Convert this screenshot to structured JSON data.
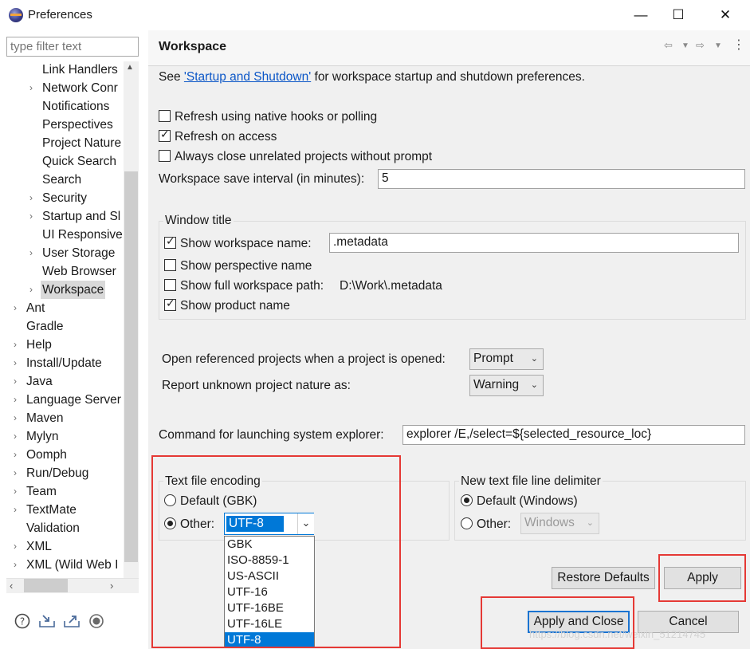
{
  "window": {
    "title": "Preferences",
    "minimize": "—",
    "maximize": "☐",
    "close": "✕"
  },
  "sidebar": {
    "filter_placeholder": "type filter text",
    "items": [
      {
        "label": "Link Handlers",
        "twisty": ""
      },
      {
        "label": "Network Conr",
        "twisty": "›"
      },
      {
        "label": "Notifications",
        "twisty": ""
      },
      {
        "label": "Perspectives",
        "twisty": ""
      },
      {
        "label": "Project Nature",
        "twisty": ""
      },
      {
        "label": "Quick Search",
        "twisty": ""
      },
      {
        "label": "Search",
        "twisty": ""
      },
      {
        "label": "Security",
        "twisty": "›"
      },
      {
        "label": "Startup and Sl",
        "twisty": "›"
      },
      {
        "label": "UI Responsive",
        "twisty": ""
      },
      {
        "label": "User Storage",
        "twisty": "›"
      },
      {
        "label": "Web Browser",
        "twisty": ""
      },
      {
        "label": "Workspace",
        "twisty": "›"
      },
      {
        "label": "Ant",
        "twisty": "›"
      },
      {
        "label": "Gradle",
        "twisty": ""
      },
      {
        "label": "Help",
        "twisty": "›"
      },
      {
        "label": "Install/Update",
        "twisty": "›"
      },
      {
        "label": "Java",
        "twisty": "›"
      },
      {
        "label": "Language Server",
        "twisty": "›"
      },
      {
        "label": "Maven",
        "twisty": "›"
      },
      {
        "label": "Mylyn",
        "twisty": "›"
      },
      {
        "label": "Oomph",
        "twisty": "›"
      },
      {
        "label": "Run/Debug",
        "twisty": "›"
      },
      {
        "label": "Team",
        "twisty": "›"
      },
      {
        "label": "TextMate",
        "twisty": "›"
      },
      {
        "label": "Validation",
        "twisty": ""
      },
      {
        "label": "XML",
        "twisty": "›"
      },
      {
        "label": "XML (Wild Web I",
        "twisty": "›"
      }
    ],
    "bottom_icons": [
      "help-icon",
      "import-icon",
      "export-icon",
      "record-icon"
    ]
  },
  "page": {
    "title": "Workspace",
    "see_prefix": "See ",
    "see_link": "'Startup and Shutdown'",
    "see_suffix": " for workspace startup and shutdown preferences.",
    "refresh_native": "Refresh using native hooks or polling",
    "refresh_access": "Refresh on access",
    "always_close": "Always close unrelated projects without prompt",
    "save_interval_label": "Workspace save interval (in minutes):",
    "save_interval_value": "5",
    "window_title_group": "Window title",
    "show_ws_name": "Show workspace name:",
    "ws_name_value": ".metadata",
    "show_perspective": "Show perspective name",
    "show_full_path": "Show full workspace path:",
    "full_path_value": "D:\\Work\\.metadata",
    "show_product": "Show product name",
    "open_ref_label": "Open referenced projects when a project is opened:",
    "open_ref_value": "Prompt",
    "report_nature_label": "Report unknown project nature as:",
    "report_nature_value": "Warning",
    "command_label": "Command for launching system explorer:",
    "command_value": "explorer /E,/select=${selected_resource_loc}",
    "encoding_group": "Text file encoding",
    "encoding_default": "Default (GBK)",
    "encoding_other": "Other:",
    "encoding_value": "UTF-8",
    "encoding_options": [
      "GBK",
      "ISO-8859-1",
      "US-ASCII",
      "UTF-16",
      "UTF-16BE",
      "UTF-16LE",
      "UTF-8"
    ],
    "delimiter_group": "New text file line delimiter",
    "delimiter_default": "Default (Windows)",
    "delimiter_other": "Other:",
    "delimiter_value": "Windows",
    "restore_defaults": "Restore Defaults",
    "apply": "Apply",
    "apply_close": "Apply and Close",
    "cancel": "Cancel",
    "watermark": "https://blog.csdn.net/weixin_51214745"
  },
  "colors": {
    "highlight_red": "#e53935",
    "selection_blue": "#0078d7",
    "link_blue": "#0b56c7"
  }
}
